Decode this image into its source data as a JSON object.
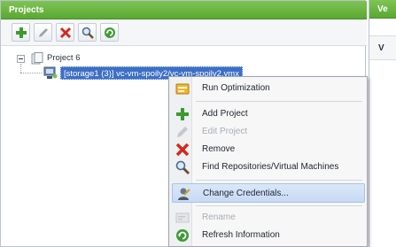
{
  "projects_panel": {
    "title": "Projects",
    "toolbar": {
      "add_label": "Add Project",
      "edit_label": "Edit Project",
      "remove_label": "Remove",
      "find_label": "Find Repositories/Virtual Machines",
      "refresh_label": "Refresh Information"
    },
    "tree": {
      "project_label": "Project 6",
      "vm_label": "[storage1 (3)] vc-vm-spoily2/vc-vm-spoily2.vmx"
    }
  },
  "right_panel": {
    "title": "Ve",
    "subheader": "V"
  },
  "context_menu": {
    "items": [
      {
        "label": "Run Optimization",
        "icon": "run-optimization-icon",
        "enabled": true
      },
      {
        "label": "Add Project",
        "icon": "add-icon",
        "enabled": true
      },
      {
        "label": "Edit Project",
        "icon": "edit-icon",
        "enabled": false
      },
      {
        "label": "Remove",
        "icon": "remove-icon",
        "enabled": true
      },
      {
        "label": "Find Repositories/Virtual Machines",
        "icon": "search-icon",
        "enabled": true
      },
      {
        "label": "Change Credentials...",
        "icon": "credentials-icon",
        "enabled": true,
        "highlighted": true
      },
      {
        "label": "Rename",
        "icon": "rename-icon",
        "enabled": false
      },
      {
        "label": "Refresh Information",
        "icon": "refresh-icon",
        "enabled": true
      }
    ]
  },
  "colors": {
    "header_green": "#5aa832",
    "selection_blue": "#3d6fc6",
    "menu_highlight": "#c7daf4"
  }
}
